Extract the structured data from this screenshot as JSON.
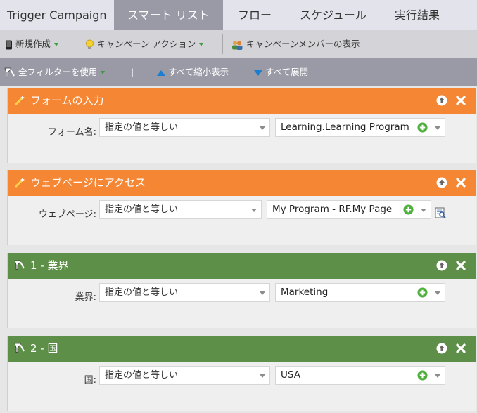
{
  "tabs": [
    {
      "label": "Trigger Campaign"
    },
    {
      "label": "スマート リスト"
    },
    {
      "label": "フロー"
    },
    {
      "label": "スケジュール"
    },
    {
      "label": "実行結果"
    }
  ],
  "toolbar": {
    "new_label": "新規作成",
    "campaign_actions_label": "キャンペーン アクション",
    "show_members_label": "キャンペーンメンバーの表示"
  },
  "filterbar": {
    "use_all_filters_label": "全フィルターを使用",
    "separator": "|",
    "collapse_all_label": "すべて縮小表示",
    "expand_all_label": "すべて展開"
  },
  "filters": [
    {
      "title": "フォームの入力",
      "color": "#f58634",
      "field_label": "フォーム名:",
      "operator": "指定の値と等しい",
      "value": "Learning.Learning Program"
    },
    {
      "title": "ウェブページにアクセス",
      "color": "#f58634",
      "field_label": "ウェブページ:",
      "operator": "指定の値と等しい",
      "value": "My Program - RF.My Page"
    },
    {
      "title": "1 - 業界",
      "color": "#5e8f48",
      "field_label": "業界:",
      "operator": "指定の値と等しい",
      "value": "Marketing"
    },
    {
      "title": "2 - 国",
      "color": "#5e8f48",
      "field_label": "国:",
      "operator": "指定の値と等しい",
      "value": "USA"
    }
  ]
}
